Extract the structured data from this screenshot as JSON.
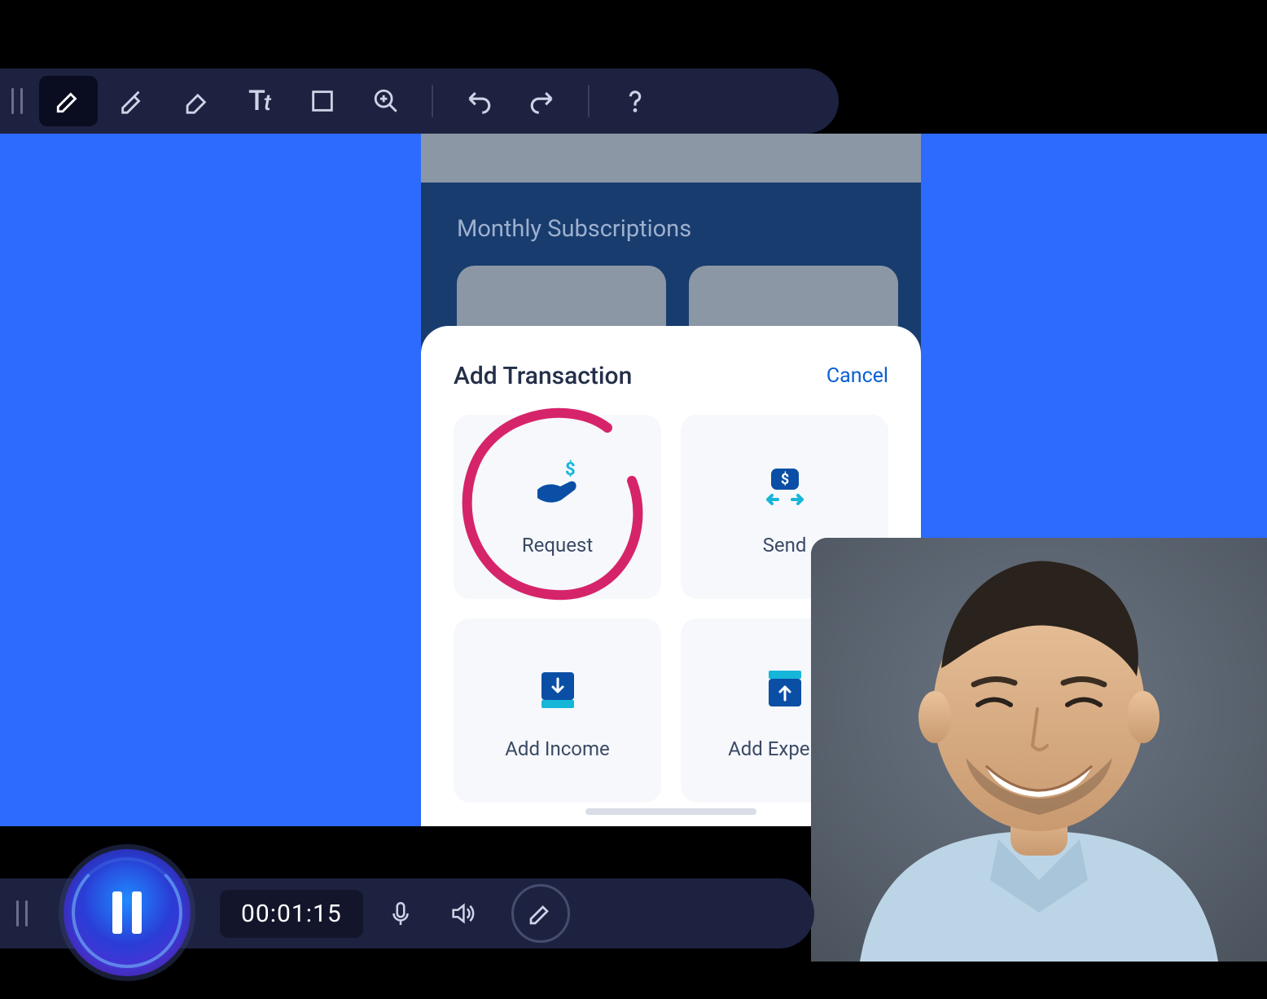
{
  "toolbar": {
    "tools": {
      "pen": "pen-tool",
      "highlighter": "highlighter-tool",
      "eraser": "eraser-tool",
      "text": "text-tool",
      "text_label": "Tt",
      "shape": "rectangle-tool",
      "zoom": "zoom-in-tool",
      "undo": "undo",
      "redo": "redo",
      "help": "help"
    }
  },
  "phone": {
    "section_title": "Monthly Subscriptions"
  },
  "sheet": {
    "title": "Add Transaction",
    "cancel": "Cancel",
    "tiles": {
      "request": "Request",
      "send": "Send",
      "add_income": "Add Income",
      "add_expense": "Add Expense"
    }
  },
  "recording": {
    "elapsed": "00:01:15"
  }
}
